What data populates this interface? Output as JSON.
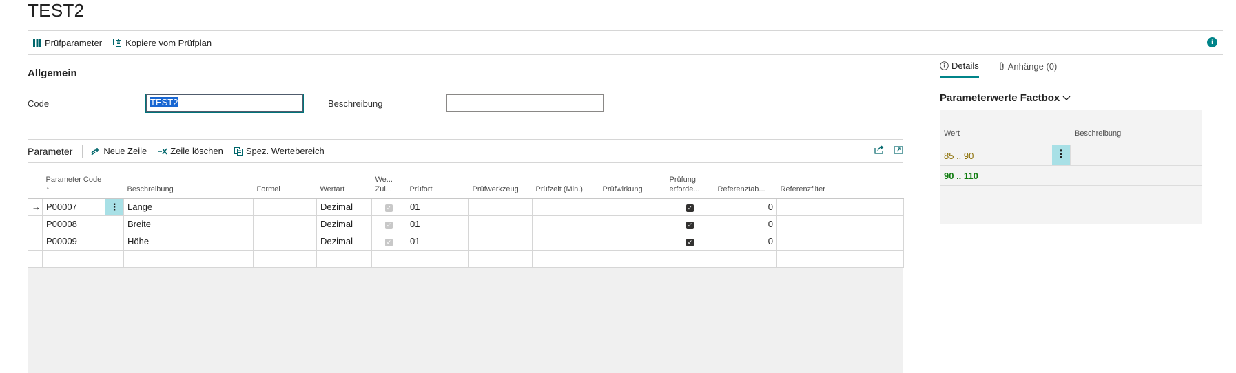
{
  "page": {
    "title": "TEST2"
  },
  "actions": [
    {
      "label": "Prüfparameter",
      "icon": "grid-icon"
    },
    {
      "label": "Kopiere vom Prüfplan",
      "icon": "copy-icon"
    }
  ],
  "general": {
    "title": "Allgemein",
    "code_label": "Code",
    "code_value": "TEST2",
    "description_label": "Beschreibung",
    "description_value": ""
  },
  "subpage": {
    "title": "Parameter",
    "actions": [
      {
        "label": "Neue Zeile",
        "icon": "new-line-icon"
      },
      {
        "label": "Zeile löschen",
        "icon": "delete-line-icon"
      },
      {
        "label": "Spez. Wertebereich",
        "icon": "copy-icon"
      }
    ],
    "columns": [
      "",
      "Parameter Code ↑",
      "",
      "Beschreibung",
      "Formel",
      "Wertart",
      "We... Zul...",
      "Prüfort",
      "Prüfwerkzeug",
      "Prüfzeit (Min.)",
      "Prüfwirkung",
      "Prüfung erforde...",
      "Referenztab...",
      "Referenzfilter"
    ],
    "rows": [
      {
        "code": "P00007",
        "description": "Länge",
        "formula": "",
        "value_type": "Dezimal",
        "location": "01",
        "tool": "",
        "time": "",
        "effect": "",
        "required": true,
        "ref_table": "0",
        "ref_filter": "",
        "selected": true
      },
      {
        "code": "P00008",
        "description": "Breite",
        "formula": "",
        "value_type": "Dezimal",
        "location": "01",
        "tool": "",
        "time": "",
        "effect": "",
        "required": true,
        "ref_table": "0",
        "ref_filter": "",
        "selected": false
      },
      {
        "code": "P00009",
        "description": "Höhe",
        "formula": "",
        "value_type": "Dezimal",
        "location": "01",
        "tool": "",
        "time": "",
        "effect": "",
        "required": true,
        "ref_table": "0",
        "ref_filter": "",
        "selected": false
      }
    ]
  },
  "factbox": {
    "tabs": [
      {
        "label": "Details",
        "icon": "info-icon",
        "active": true
      },
      {
        "label": "Anhänge (0)",
        "icon": "paperclip-icon",
        "active": false
      }
    ],
    "title": "Parameterwerte Factbox",
    "col_value": "Wert",
    "col_description": "Beschreibung",
    "rows": [
      {
        "value": "85 .. 90",
        "description": ""
      },
      {
        "value": "90 .. 110",
        "description": ""
      }
    ]
  },
  "colors": {
    "accent": "#008489",
    "selection": "#a8e0e6",
    "link_gold": "#8a6d00",
    "green": "#107c10"
  }
}
